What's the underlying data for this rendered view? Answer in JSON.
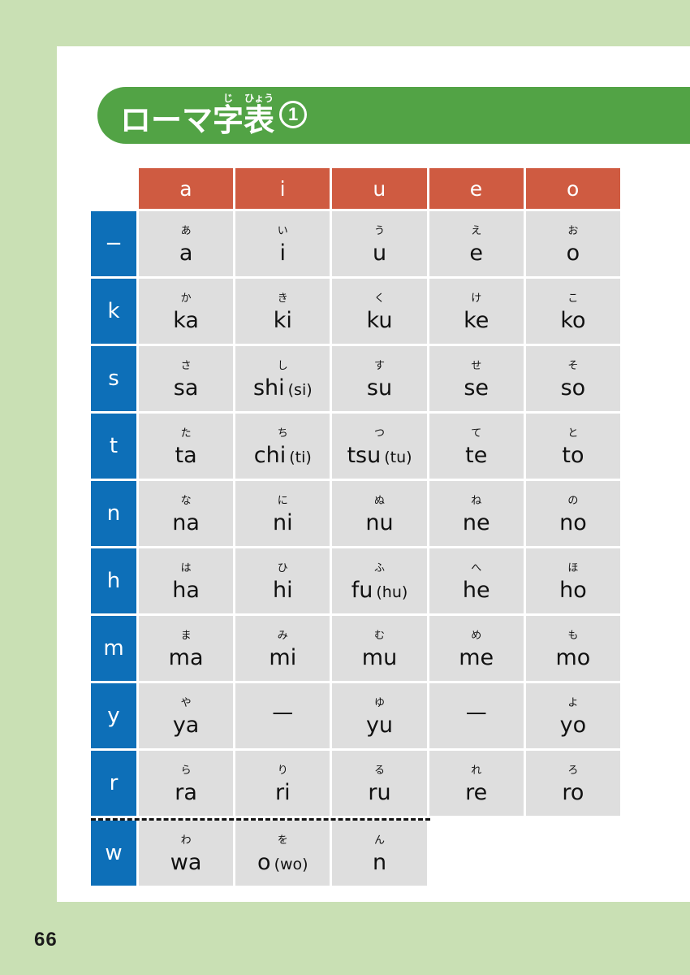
{
  "page": {
    "number": "66",
    "background_color": "#c9e0b4",
    "sheet_color": "#ffffff"
  },
  "title": {
    "segments": [
      {
        "base": "ロ",
        "ruby": ""
      },
      {
        "base": "ー",
        "ruby": ""
      },
      {
        "base": "マ",
        "ruby": ""
      },
      {
        "base": "字",
        "ruby": "じ"
      },
      {
        "base": "表",
        "ruby": "ひょう"
      }
    ],
    "plain": "ローマ字表",
    "number_badge": "1",
    "banner_color": "#52a345"
  },
  "table": {
    "corner_label": "",
    "column_headers": [
      "a",
      "i",
      "u",
      "e",
      "o"
    ],
    "header_color": "#cf5b41",
    "row_header_color": "#0d6fb8",
    "cell_color": "#dedede",
    "dashed_separator_before_row": "w",
    "rows": [
      {
        "label": "−",
        "cells": [
          {
            "kana": "あ",
            "romaji": "a",
            "alt": ""
          },
          {
            "kana": "い",
            "romaji": "i",
            "alt": ""
          },
          {
            "kana": "う",
            "romaji": "u",
            "alt": ""
          },
          {
            "kana": "え",
            "romaji": "e",
            "alt": ""
          },
          {
            "kana": "お",
            "romaji": "o",
            "alt": ""
          }
        ]
      },
      {
        "label": "k",
        "cells": [
          {
            "kana": "か",
            "romaji": "ka",
            "alt": ""
          },
          {
            "kana": "き",
            "romaji": "ki",
            "alt": ""
          },
          {
            "kana": "く",
            "romaji": "ku",
            "alt": ""
          },
          {
            "kana": "け",
            "romaji": "ke",
            "alt": ""
          },
          {
            "kana": "こ",
            "romaji": "ko",
            "alt": ""
          }
        ]
      },
      {
        "label": "s",
        "cells": [
          {
            "kana": "さ",
            "romaji": "sa",
            "alt": ""
          },
          {
            "kana": "し",
            "romaji": "shi",
            "alt": "(si)"
          },
          {
            "kana": "す",
            "romaji": "su",
            "alt": ""
          },
          {
            "kana": "せ",
            "romaji": "se",
            "alt": ""
          },
          {
            "kana": "そ",
            "romaji": "so",
            "alt": ""
          }
        ]
      },
      {
        "label": "t",
        "cells": [
          {
            "kana": "た",
            "romaji": "ta",
            "alt": ""
          },
          {
            "kana": "ち",
            "romaji": "chi",
            "alt": "(ti)"
          },
          {
            "kana": "つ",
            "romaji": "tsu",
            "alt": "(tu)"
          },
          {
            "kana": "て",
            "romaji": "te",
            "alt": ""
          },
          {
            "kana": "と",
            "romaji": "to",
            "alt": ""
          }
        ]
      },
      {
        "label": "n",
        "cells": [
          {
            "kana": "な",
            "romaji": "na",
            "alt": ""
          },
          {
            "kana": "に",
            "romaji": "ni",
            "alt": ""
          },
          {
            "kana": "ぬ",
            "romaji": "nu",
            "alt": ""
          },
          {
            "kana": "ね",
            "romaji": "ne",
            "alt": ""
          },
          {
            "kana": "の",
            "romaji": "no",
            "alt": ""
          }
        ]
      },
      {
        "label": "h",
        "cells": [
          {
            "kana": "は",
            "romaji": "ha",
            "alt": ""
          },
          {
            "kana": "ひ",
            "romaji": "hi",
            "alt": ""
          },
          {
            "kana": "ふ",
            "romaji": "fu",
            "alt": "(hu)"
          },
          {
            "kana": "へ",
            "romaji": "he",
            "alt": ""
          },
          {
            "kana": "ほ",
            "romaji": "ho",
            "alt": ""
          }
        ]
      },
      {
        "label": "m",
        "cells": [
          {
            "kana": "ま",
            "romaji": "ma",
            "alt": ""
          },
          {
            "kana": "み",
            "romaji": "mi",
            "alt": ""
          },
          {
            "kana": "む",
            "romaji": "mu",
            "alt": ""
          },
          {
            "kana": "め",
            "romaji": "me",
            "alt": ""
          },
          {
            "kana": "も",
            "romaji": "mo",
            "alt": ""
          }
        ]
      },
      {
        "label": "y",
        "cells": [
          {
            "kana": "や",
            "romaji": "ya",
            "alt": ""
          },
          {
            "kana": "",
            "romaji": "—",
            "alt": ""
          },
          {
            "kana": "ゆ",
            "romaji": "yu",
            "alt": ""
          },
          {
            "kana": "",
            "romaji": "—",
            "alt": ""
          },
          {
            "kana": "よ",
            "romaji": "yo",
            "alt": ""
          }
        ]
      },
      {
        "label": "r",
        "cells": [
          {
            "kana": "ら",
            "romaji": "ra",
            "alt": ""
          },
          {
            "kana": "り",
            "romaji": "ri",
            "alt": ""
          },
          {
            "kana": "る",
            "romaji": "ru",
            "alt": ""
          },
          {
            "kana": "れ",
            "romaji": "re",
            "alt": ""
          },
          {
            "kana": "ろ",
            "romaji": "ro",
            "alt": ""
          }
        ]
      },
      {
        "label": "w",
        "cells": [
          {
            "kana": "わ",
            "romaji": "wa",
            "alt": ""
          },
          {
            "kana": "を",
            "romaji": "o",
            "alt": "(wo)"
          },
          {
            "kana": "ん",
            "romaji": "n",
            "alt": ""
          },
          {
            "kana": "",
            "romaji": "",
            "alt": "",
            "blank": true
          },
          {
            "kana": "",
            "romaji": "",
            "alt": "",
            "blank": true
          }
        ]
      }
    ]
  }
}
